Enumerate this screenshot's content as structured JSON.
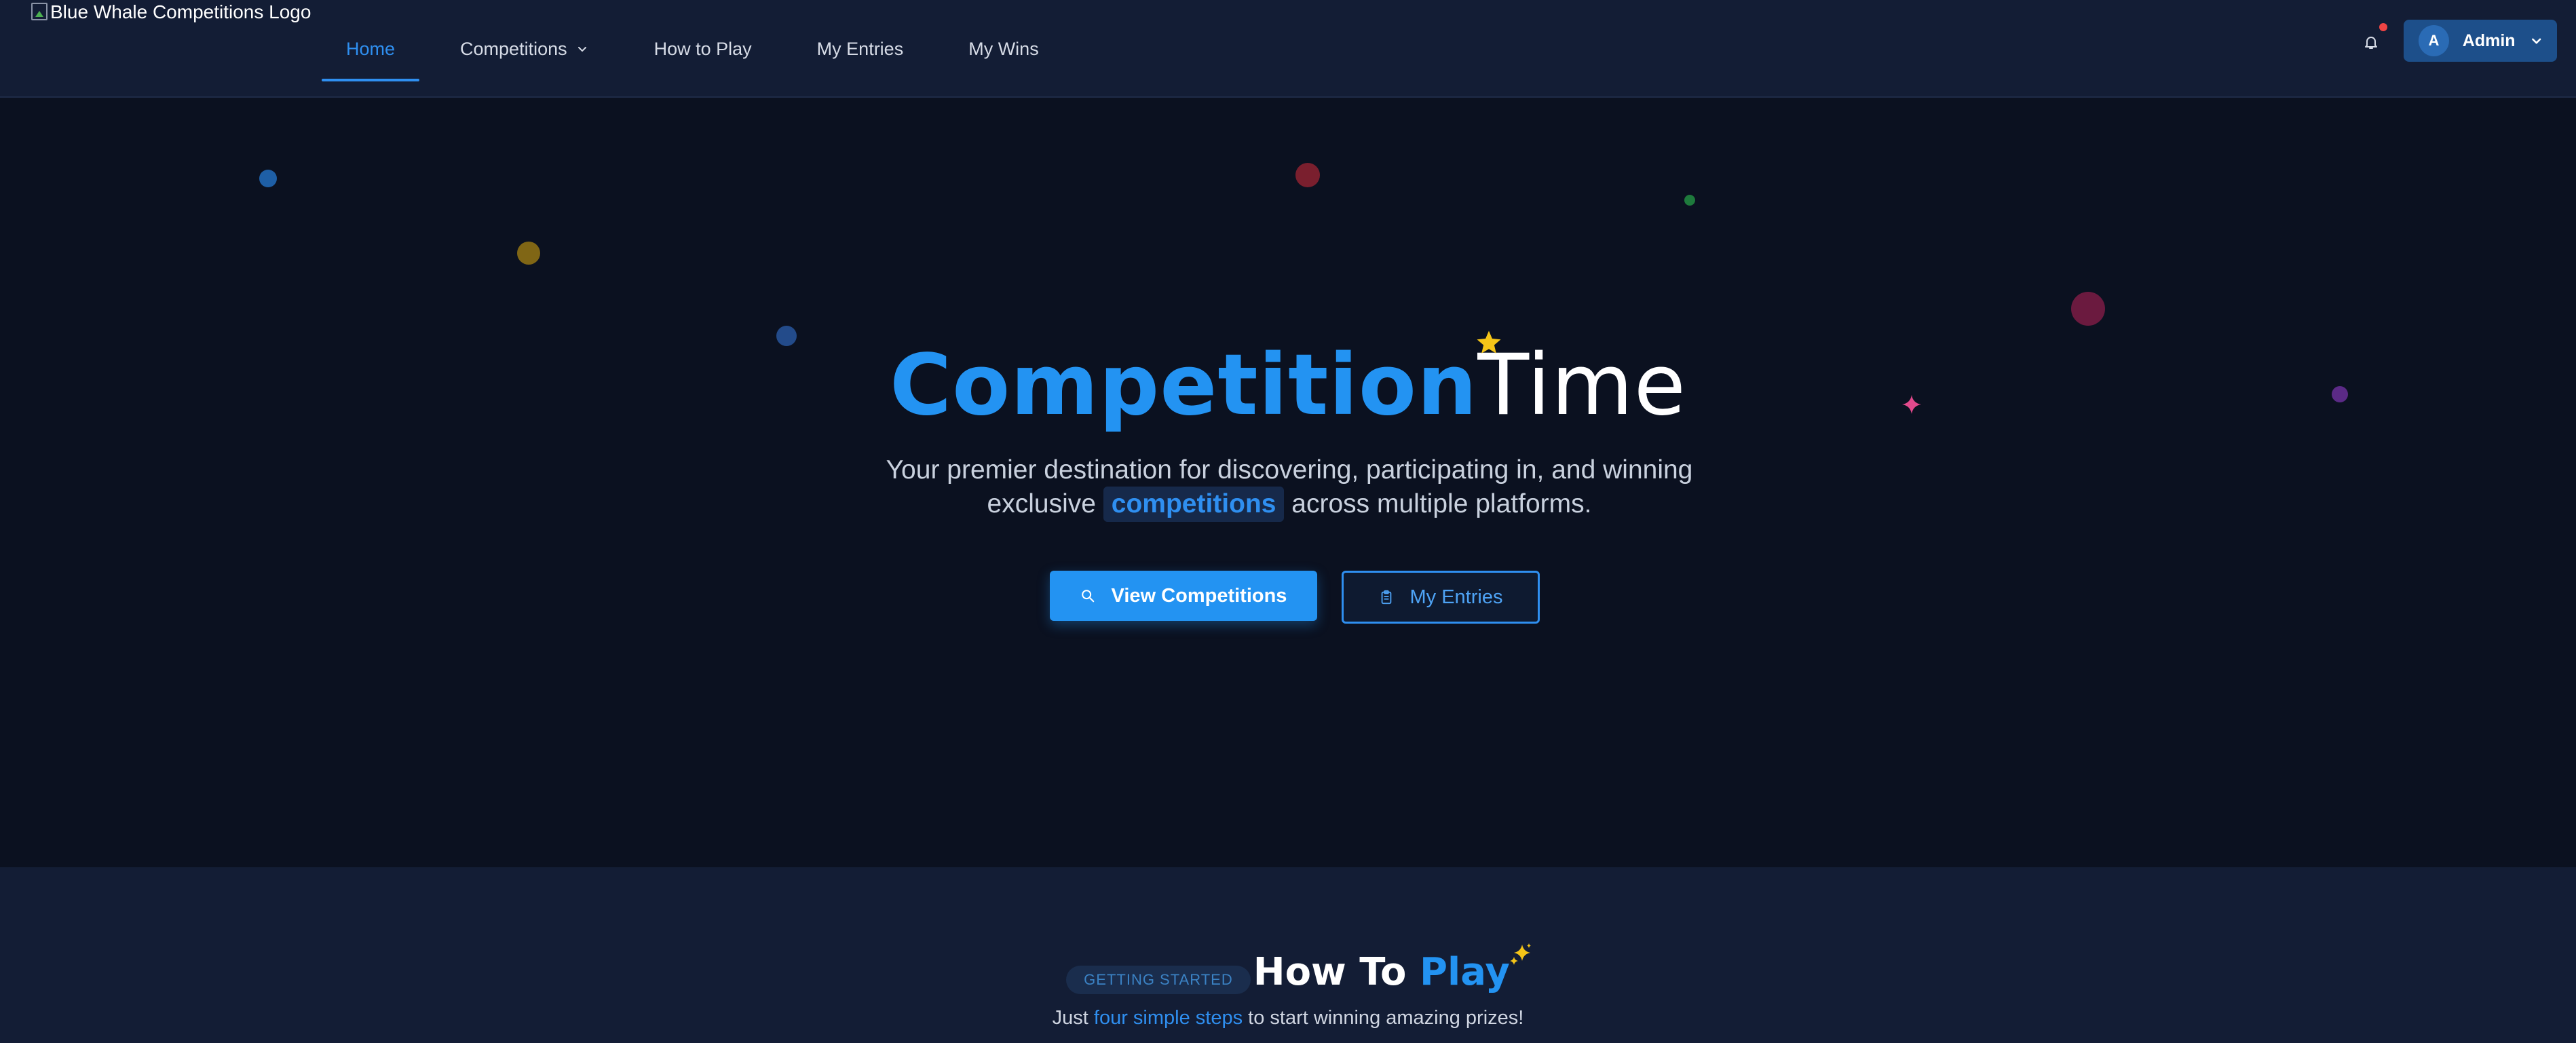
{
  "nav": {
    "logo_alt": "Blue Whale Competitions Logo",
    "links": [
      {
        "label": "Home",
        "active": true
      },
      {
        "label": "Competitions",
        "has_dropdown": true
      },
      {
        "label": "How to Play"
      },
      {
        "label": "My Entries"
      },
      {
        "label": "My Wins"
      }
    ],
    "notification_icon": "bell-icon",
    "user": {
      "initial": "A",
      "name": "Admin"
    }
  },
  "hero": {
    "title_bold": "Competition",
    "title_light": "Time",
    "subtitle_before": "Your premier destination for discovering, participating in, and winning exclusive ",
    "subtitle_highlight": "competitions",
    "subtitle_after": " across multiple platforms.",
    "primary_button": {
      "label": "View Competitions",
      "icon": "search-icon"
    },
    "secondary_button": {
      "label": "My Entries",
      "icon": "clipboard-icon"
    }
  },
  "how_to_play": {
    "badge": "GETTING STARTED",
    "title_plain": "How To ",
    "title_accent": "Play",
    "subtitle_before": "Just ",
    "subtitle_accent": "four simple steps",
    "subtitle_after": " to start winning amazing prizes!"
  },
  "colors": {
    "accent": "#2393f2",
    "navbar_bg": "#131d35",
    "hero_bg": "#0b1120"
  }
}
